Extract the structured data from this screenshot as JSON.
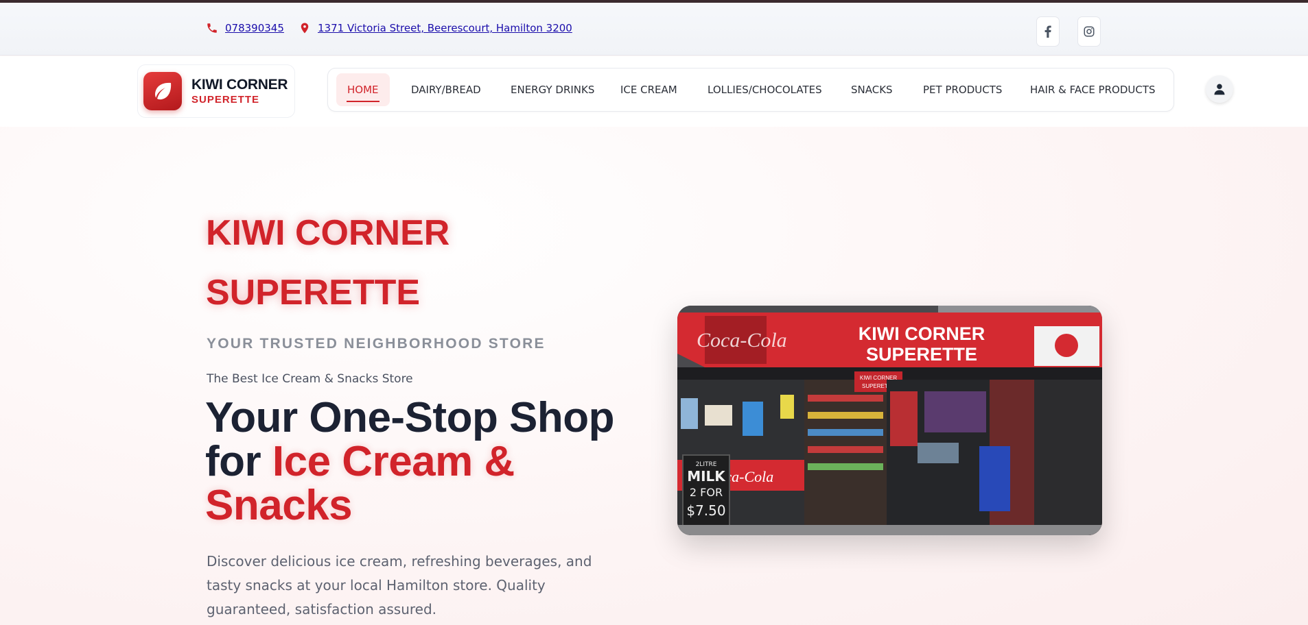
{
  "topbar": {
    "phone": "078390345",
    "address": "1371 Victoria Street, Beerescourt, Hamilton 3200",
    "icons": {
      "phone": "phone-icon",
      "address": "map-pin-icon",
      "facebook": "facebook-icon",
      "instagram": "instagram-icon"
    }
  },
  "logo": {
    "title": "KIWI CORNER",
    "subtitle": "SUPERETTE",
    "icon": "leaf-icon"
  },
  "nav": {
    "items": [
      {
        "label": "HOME",
        "active": true
      },
      {
        "label": "DAIRY/BREAD"
      },
      {
        "label": "ENERGY DRINKS"
      },
      {
        "label": "ICE CREAM"
      },
      {
        "label": "LOLLIES/CHOCOLATES"
      },
      {
        "label": "SNACKS"
      },
      {
        "label": "PET PRODUCTS"
      },
      {
        "label": "HAIR & FACE PRODUCTS"
      }
    ],
    "user_icon": "user-icon"
  },
  "hero": {
    "brand_line1": "KIWI CORNER",
    "brand_line2": "SUPERETTE",
    "tagline": "YOUR TRUSTED NEIGHBORHOOD STORE",
    "subtitle": "The Best Ice Cream & Snacks Store",
    "headline_part1": "Your One-Stop Shop for ",
    "headline_accent": "Ice Cream & Snacks",
    "description": "Discover delicious ice cream, refreshing beverages, and tasty snacks at your local Hamilton store. Quality guaranteed, satisfaction assured.",
    "photo": {
      "sign_line1": "KIWI CORNER",
      "sign_line2": "SUPERETTE",
      "small_sign_line1": "KIWI CORNER",
      "small_sign_line2": "SUPERETTE",
      "board_line1": "2LITRE",
      "board_line2": "MILK",
      "board_line3": "2 FOR",
      "board_line4": "$7.50",
      "coke_text": "Coca-Cola"
    }
  },
  "colors": {
    "accent": "#d1232a",
    "dark": "#1c2233",
    "muted": "#8a8f99"
  }
}
